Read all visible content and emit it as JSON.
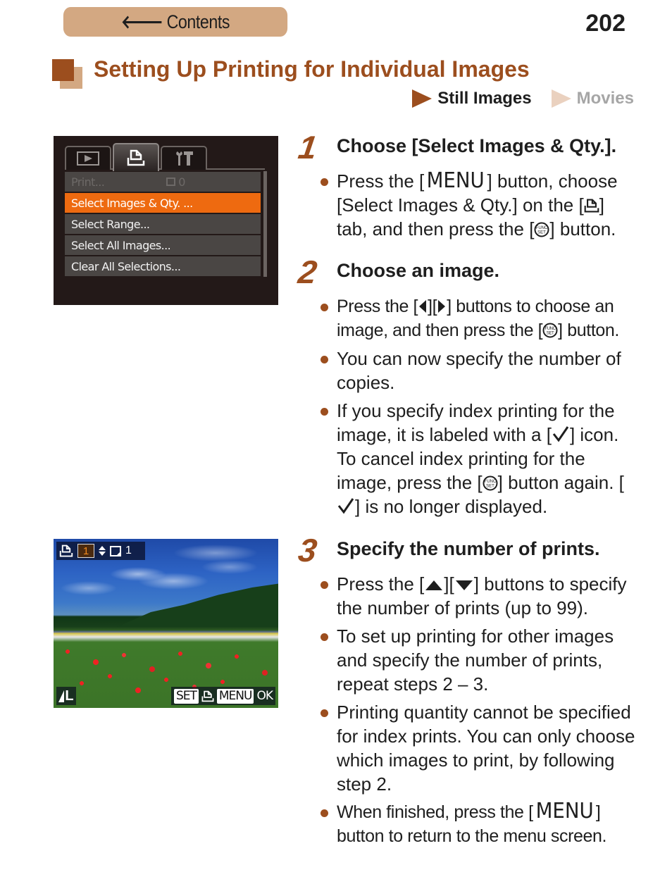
{
  "nav": {
    "contents_label": "Contents",
    "back_arrow": "🡐"
  },
  "page_number": "202",
  "header": {
    "title": "Setting Up Printing for Individual Images",
    "modes": {
      "still": "Still Images",
      "movies": "Movies"
    }
  },
  "camera_menu": {
    "tabs": [
      "play-tab",
      "print-tab",
      "setup-tab"
    ],
    "active_tab": "print-tab",
    "items": [
      {
        "label": "Print...",
        "state": "disabled",
        "qty": "0"
      },
      {
        "label": "Select Images & Qty. ...",
        "state": "selected"
      },
      {
        "label": "Select Range...",
        "state": "normal"
      },
      {
        "label": "Select All Images...",
        "state": "normal"
      },
      {
        "label": "Clear All Selections...",
        "state": "normal"
      }
    ]
  },
  "camera_photo": {
    "copies": "1",
    "index_count": "1",
    "size": "L",
    "set_label": "SET",
    "menu_label": "MENU",
    "ok_label": "OK"
  },
  "steps": [
    {
      "number": "1",
      "title": "Choose [Select Images & Qty.].",
      "bullets": [
        {
          "parts": [
            "Press the [",
            "MENU",
            "] button, choose [Select Images & Qty.] on the [",
            "print-icon",
            "] tab, and then press the [",
            "func-set-icon",
            "] button."
          ]
        }
      ]
    },
    {
      "number": "2",
      "title": "Choose an image.",
      "bullets": [
        {
          "parts": [
            "Press the [",
            "left-icon",
            "][",
            "right-icon",
            "] buttons to choose an image, and then press the [",
            "func-set-icon",
            "] button."
          ]
        },
        {
          "text": "You can now specify the number of copies."
        },
        {
          "parts": [
            "If you specify index printing for the image, it is labeled with a [",
            "check-icon",
            "] icon. To cancel index printing for the image, press the [",
            "func-set-icon",
            "] button again. [",
            "check-icon",
            "] is no longer displayed."
          ]
        }
      ]
    },
    {
      "number": "3",
      "title": "Specify the number of prints.",
      "bullets": [
        {
          "parts": [
            "Press the [",
            "up-icon",
            "][",
            "down-icon",
            "] buttons to specify the number of prints (up to 99)."
          ]
        },
        {
          "text": "To set up printing for other images and specify the number of prints, repeat steps 2 – 3."
        },
        {
          "text": "Printing quantity cannot be specified for index prints. You can only choose which images to print, by following step 2."
        },
        {
          "parts": [
            "When finished, press the [",
            "MENU",
            "] button to return to the menu screen."
          ]
        }
      ]
    }
  ],
  "colors": {
    "accent": "#9c4e1e",
    "accent_light": "#d3a882",
    "menu_highlight": "#ee6a10"
  }
}
